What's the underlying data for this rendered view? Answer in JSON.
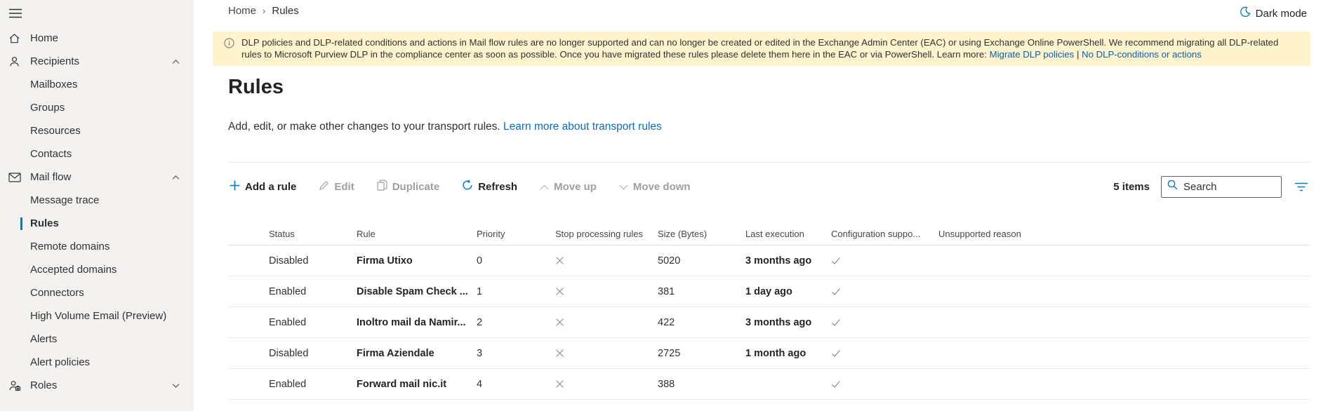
{
  "colors": {
    "accent": "#0078d4",
    "banner_bg": "#fff4ce",
    "sidebar_bg": "#f3f2f1",
    "selected_bar": "#0078d4"
  },
  "breadcrumb": {
    "home": "Home",
    "current": "Rules"
  },
  "topbar": {
    "dark_mode_label": "Dark mode"
  },
  "sidebar": {
    "items": [
      {
        "label": "Home"
      },
      {
        "label": "Recipients"
      },
      {
        "label": "Mailboxes"
      },
      {
        "label": "Groups"
      },
      {
        "label": "Resources"
      },
      {
        "label": "Contacts"
      },
      {
        "label": "Mail flow"
      },
      {
        "label": "Message trace"
      },
      {
        "label": "Rules"
      },
      {
        "label": "Remote domains"
      },
      {
        "label": "Accepted domains"
      },
      {
        "label": "Connectors"
      },
      {
        "label": "High Volume Email (Preview)"
      },
      {
        "label": "Alerts"
      },
      {
        "label": "Alert policies"
      },
      {
        "label": "Roles"
      }
    ]
  },
  "banner": {
    "text": "DLP policies and DLP-related conditions and actions in Mail flow rules are no longer supported and can no longer be created or edited in the Exchange Admin Center (EAC) or using Exchange Online PowerShell. We recommend migrating all DLP-related rules to Microsoft Purview DLP in the compliance center as soon as possible. Once you have migrated these rules please delete them here in the EAC or via PowerShell. Learn more:",
    "link1": "Migrate DLP policies",
    "separator": "|",
    "link2": "No DLP-conditions or actions"
  },
  "page": {
    "title": "Rules",
    "subtitle": "Add, edit, or make other changes to your transport rules.",
    "subtitle_link": "Learn more about transport rules"
  },
  "toolbar": {
    "buttons": [
      {
        "label": "Add a rule",
        "enabled": true
      },
      {
        "label": "Edit",
        "enabled": false
      },
      {
        "label": "Duplicate",
        "enabled": false
      },
      {
        "label": "Refresh",
        "enabled": true
      },
      {
        "label": "Move up",
        "enabled": false
      },
      {
        "label": "Move down",
        "enabled": false
      }
    ],
    "items_count": "5 items",
    "search_placeholder": "Search"
  },
  "table": {
    "columns": [
      "Status",
      "Rule",
      "Priority",
      "Stop processing rules",
      "Size (Bytes)",
      "Last execution",
      "Configuration suppo...",
      "Unsupported reason"
    ],
    "rows": [
      {
        "status": "Disabled",
        "rule": "Firma Utixo",
        "priority": "0",
        "size": "5020",
        "last_execution": "3 months ago",
        "unsupported": ""
      },
      {
        "status": "Enabled",
        "rule": "Disable Spam Check ...",
        "priority": "1",
        "size": "381",
        "last_execution": "1 day ago",
        "unsupported": ""
      },
      {
        "status": "Enabled",
        "rule": "Inoltro mail da Namir...",
        "priority": "2",
        "size": "422",
        "last_execution": "3 months ago",
        "unsupported": ""
      },
      {
        "status": "Disabled",
        "rule": "Firma Aziendale",
        "priority": "3",
        "size": "2725",
        "last_execution": "1 month ago",
        "unsupported": ""
      },
      {
        "status": "Enabled",
        "rule": "Forward mail nic.it",
        "priority": "4",
        "size": "388",
        "last_execution": "",
        "unsupported": ""
      }
    ]
  }
}
